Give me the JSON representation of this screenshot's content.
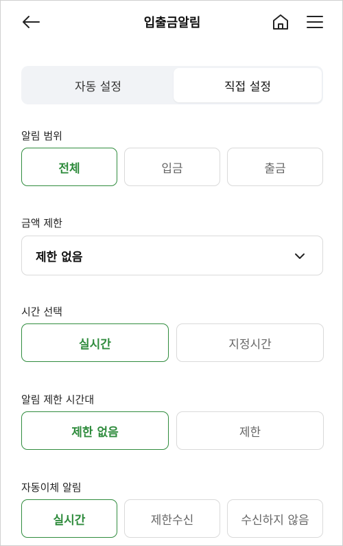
{
  "header": {
    "title": "입출금알림",
    "back_icon": "arrow-left-icon",
    "home_icon": "home-icon",
    "menu_icon": "hamburger-menu-icon"
  },
  "mode_tabs": {
    "auto": "자동 설정",
    "manual": "직접 설정",
    "selected": "manual"
  },
  "alert_range": {
    "label": "알림 범위",
    "options": [
      "전체",
      "입금",
      "출금"
    ],
    "selected": "전체"
  },
  "amount_limit": {
    "label": "금액 제한",
    "value": "제한 없음",
    "icon": "chevron-down-icon"
  },
  "time_select": {
    "label": "시간 선택",
    "options": [
      "실시간",
      "지정시간"
    ],
    "selected": "실시간"
  },
  "restrict_time": {
    "label": "알림 제한 시간대",
    "options": [
      "제한 없음",
      "제한"
    ],
    "selected": "제한 없음"
  },
  "auto_transfer": {
    "label": "자동이체 알림",
    "options": [
      "실시간",
      "제한수신",
      "수신하지 않음"
    ],
    "selected": "실시간"
  },
  "colors": {
    "accent": "#2e8b3c",
    "tab_bg": "#f1f3f6",
    "border": "#d9d9d9"
  }
}
